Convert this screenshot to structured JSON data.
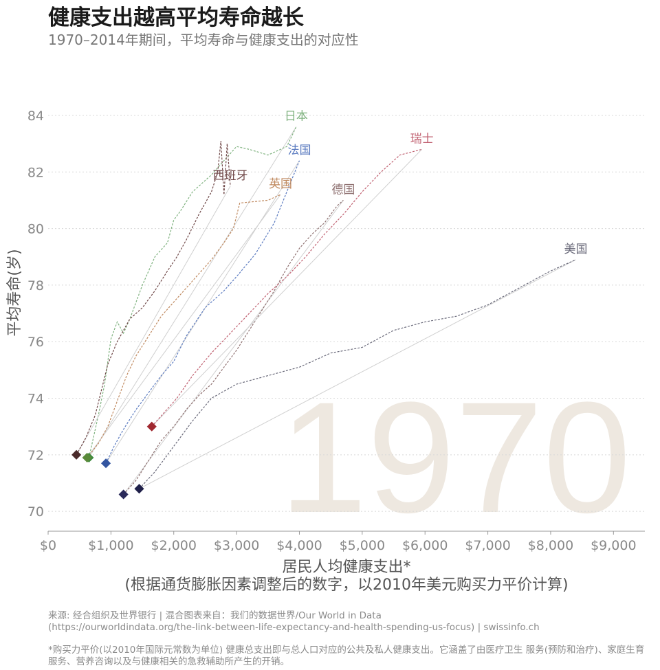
{
  "title": "健康支出越高平均寿命越长",
  "subtitle": "1970–2014年期间，平均寿命与健康支出的对应性",
  "source_line1": "来源: 经合组织及世界银行 | 混合图表来自：我们的数据世界/Our World in Data",
  "source_line2": "(https://ourworldindata.org/the-link-between-life-expectancy-and-health-spending-us-focus) | swissinfo.ch",
  "note": "*购买力平价(以2010年国际元常数为单位) 健康总支出即与总人口对应的公共及私人健康支出。它涵盖了由医疗卫生 服务(预防和治疗)、家庭生育服务、营养咨询以及与健康相关的急救辅助所产生的开销。",
  "chart_data": {
    "type": "line",
    "year_label": "1970",
    "xlabel": "居民人均健康支出*",
    "xlabel2": "(根据通货膨胀因素调整后的数字，以2010年美元购买力平价计算)",
    "ylabel": "平均寿命(岁)",
    "xlim": [
      0,
      9500
    ],
    "ylim": [
      69.3,
      84.8
    ],
    "xticks": [
      0,
      1000,
      2000,
      3000,
      4000,
      5000,
      6000,
      7000,
      8000,
      9000
    ],
    "xtick_labels": [
      "$0",
      "$1,000",
      "$2,000",
      "$3,000",
      "$4,000",
      "$5,000",
      "$6,000",
      "$7,000",
      "$8,000",
      "$9,000"
    ],
    "yticks": [
      70,
      72,
      74,
      76,
      78,
      80,
      82,
      84
    ],
    "grid": true,
    "series": [
      {
        "name": "日本",
        "color": "#7fb27f",
        "marker_color": "#3d8a3d",
        "x": [
          650,
          720,
          800,
          900,
          1000,
          1100,
          1200,
          1300,
          1500,
          1700,
          1900,
          2000,
          2100,
          2300,
          2600,
          2800,
          3000,
          3200,
          3500,
          3800,
          3950
        ],
        "y": [
          71.9,
          72.6,
          73.4,
          74.5,
          76.1,
          76.7,
          76.3,
          76.8,
          78.0,
          79.0,
          79.5,
          80.3,
          80.6,
          81.3,
          81.9,
          82.4,
          82.9,
          82.8,
          82.6,
          82.9,
          83.6
        ]
      },
      {
        "name": "西班牙",
        "color": "#6e4646",
        "marker_color": "#4a2a2a",
        "x": [
          450,
          600,
          750,
          850,
          950,
          1100,
          1300,
          1500,
          1700,
          1900,
          2050,
          2200,
          2400,
          2600,
          2700,
          2750,
          2800,
          2850,
          2900
        ],
        "y": [
          72.0,
          72.6,
          73.4,
          74.3,
          75.2,
          76.0,
          76.8,
          77.2,
          77.8,
          78.5,
          79.0,
          79.6,
          80.5,
          81.3,
          82.0,
          83.1,
          81.2,
          83.0,
          81.5
        ]
      },
      {
        "name": "法国",
        "color": "#5b7bc0",
        "marker_color": "#3355a0",
        "x": [
          920,
          1050,
          1200,
          1400,
          1600,
          1800,
          2000,
          2200,
          2500,
          2800,
          3000,
          3300,
          3600,
          3800,
          4000
        ],
        "y": [
          71.7,
          72.3,
          72.9,
          73.6,
          74.2,
          74.8,
          75.3,
          76.2,
          77.2,
          77.8,
          78.3,
          79.1,
          80.2,
          81.3,
          82.4
        ]
      },
      {
        "name": "英国",
        "color": "#c08a60",
        "marker_color": "#5a8a3a",
        "x": [
          620,
          800,
          950,
          1100,
          1250,
          1400,
          1600,
          1800,
          2000,
          2200,
          2400,
          2600,
          2800,
          2950,
          3050,
          3500,
          3700
        ],
        "y": [
          71.9,
          72.4,
          73.0,
          73.9,
          74.8,
          75.5,
          76.2,
          76.9,
          77.4,
          77.9,
          78.4,
          78.9,
          79.5,
          80.0,
          80.9,
          81.0,
          81.2
        ]
      },
      {
        "name": "德国",
        "color": "#8e7070",
        "marker_color": "#2a2a5a",
        "x": [
          1200,
          1400,
          1600,
          1800,
          2000,
          2200,
          2400,
          2600,
          2800,
          3000,
          3200,
          3400,
          3600,
          3800,
          4000,
          4200,
          4400,
          4600,
          4700
        ],
        "y": [
          70.6,
          71.1,
          71.8,
          72.5,
          73.0,
          73.6,
          74.1,
          74.5,
          75.1,
          75.7,
          76.4,
          77.1,
          77.8,
          78.6,
          79.3,
          79.8,
          80.2,
          80.8,
          81.0
        ]
      },
      {
        "name": "瑞士",
        "color": "#c06070",
        "marker_color": "#a02830",
        "x": [
          1650,
          1850,
          2050,
          2300,
          2600,
          2900,
          3200,
          3500,
          3800,
          4100,
          4400,
          4700,
          5000,
          5300,
          5600,
          5950
        ],
        "y": [
          73.0,
          73.5,
          74.0,
          74.8,
          75.6,
          76.3,
          77.0,
          77.7,
          78.3,
          79.0,
          79.8,
          80.5,
          81.3,
          82.0,
          82.6,
          82.8
        ]
      },
      {
        "name": "美国",
        "color": "#6a6a7a",
        "marker_color": "#20204a",
        "x": [
          1450,
          1700,
          2000,
          2300,
          2600,
          3000,
          3500,
          4000,
          4500,
          5000,
          5500,
          6000,
          6500,
          7000,
          7500,
          8000,
          8400
        ],
        "y": [
          70.8,
          71.4,
          72.3,
          73.2,
          74.0,
          74.5,
          74.8,
          75.1,
          75.6,
          75.8,
          76.4,
          76.7,
          76.9,
          77.3,
          77.9,
          78.5,
          78.9
        ]
      }
    ]
  }
}
